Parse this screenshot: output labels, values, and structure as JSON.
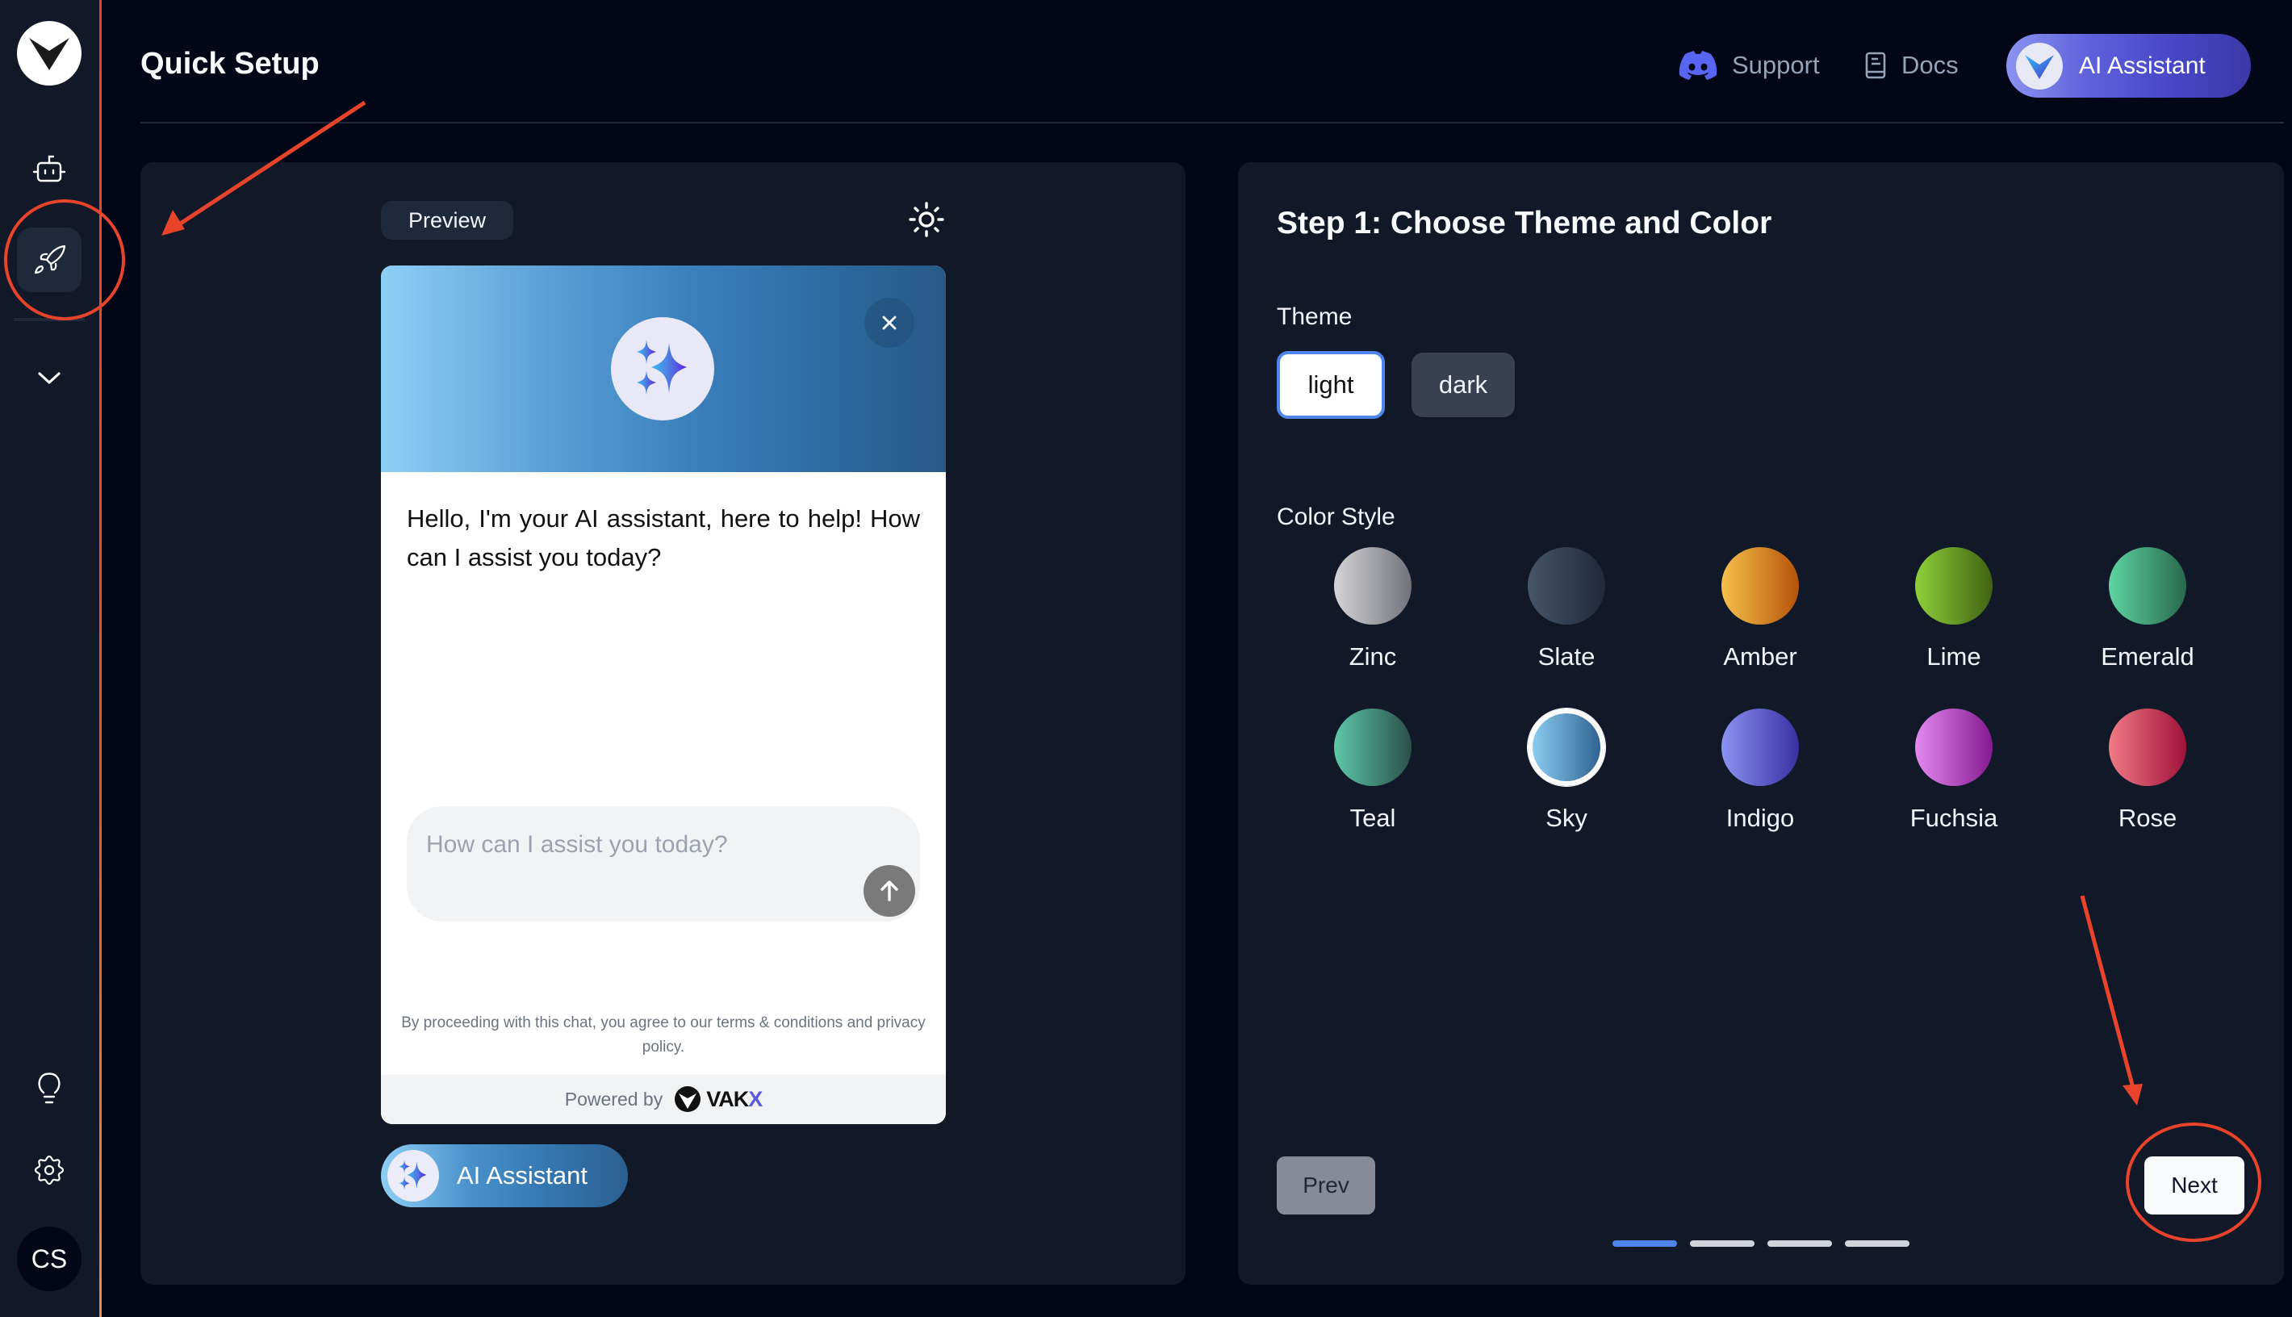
{
  "sidebar": {
    "logo": "vakx-logo",
    "items": [
      {
        "name": "bot",
        "icon": "bot-icon",
        "active": false
      },
      {
        "name": "quick-setup",
        "icon": "rocket-icon",
        "active": true
      },
      {
        "name": "expand",
        "icon": "chevron-down-icon",
        "active": false
      }
    ],
    "bottom_items": [
      {
        "name": "tips",
        "icon": "lightbulb-icon"
      },
      {
        "name": "settings",
        "icon": "gear-icon"
      }
    ],
    "avatar_initials": "CS"
  },
  "header": {
    "title": "Quick Setup",
    "links": [
      {
        "label": "Support",
        "icon": "discord-icon"
      },
      {
        "label": "Docs",
        "icon": "book-icon"
      }
    ],
    "ai_button_label": "AI Assistant"
  },
  "preview": {
    "badge": "Preview",
    "theme_toggle_icon": "sun-icon",
    "chat": {
      "greeting": "Hello, I'm your AI assistant, here to help! How can I assist you today?",
      "input_placeholder": "How can I assist you today?",
      "input_value": "",
      "terms": "By proceeding with this chat, you agree to our terms & conditions and privacy policy.",
      "powered_by": "Powered by",
      "brand": "VAK",
      "brand_accent": "X"
    },
    "launcher_label": "AI Assistant"
  },
  "setup": {
    "step_title": "Step 1: Choose Theme and Color",
    "theme_label": "Theme",
    "themes": [
      {
        "label": "light",
        "selected": true
      },
      {
        "label": "dark",
        "selected": false
      }
    ],
    "color_label": "Color Style",
    "colors": [
      {
        "label": "Zinc",
        "from": "#d4d4d8",
        "to": "#71717a",
        "selected": false
      },
      {
        "label": "Slate",
        "from": "#475569",
        "to": "#1e293b",
        "selected": false
      },
      {
        "label": "Amber",
        "from": "#f6c04b",
        "to": "#b45309",
        "selected": false
      },
      {
        "label": "Lime",
        "from": "#8fcf3a",
        "to": "#3f6212",
        "selected": false
      },
      {
        "label": "Emerald",
        "from": "#5fd4a0",
        "to": "#27684e",
        "selected": false
      },
      {
        "label": "Teal",
        "from": "#5ec7a8",
        "to": "#2a4f4a",
        "selected": false
      },
      {
        "label": "Sky",
        "from": "#8fd0f5",
        "to": "#2b5f8e",
        "selected": true
      },
      {
        "label": "Indigo",
        "from": "#8b93f0",
        "to": "#3730a3",
        "selected": false
      },
      {
        "label": "Fuchsia",
        "from": "#e28af0",
        "to": "#86198f",
        "selected": false
      },
      {
        "label": "Rose",
        "from": "#f07a85",
        "to": "#9f1239",
        "selected": false
      }
    ],
    "prev_label": "Prev",
    "next_label": "Next",
    "progress": {
      "current_step": 1,
      "total_steps": 4
    }
  },
  "colors": {
    "accent": "#4f86ee",
    "annotation": "#e8432b",
    "page_bg": "#020617",
    "panel_bg": "#111827"
  }
}
